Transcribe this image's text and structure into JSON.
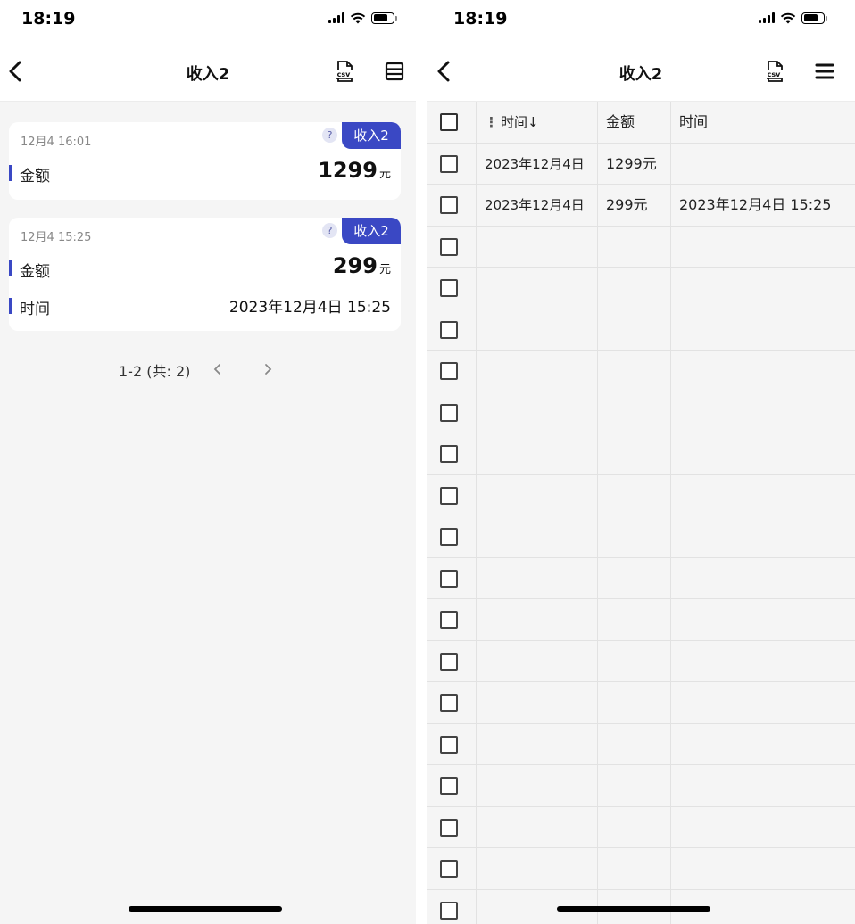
{
  "left": {
    "status": {
      "time": "18:19"
    },
    "nav": {
      "title": "收入2"
    },
    "records": [
      {
        "timestamp": "12月4 16:01",
        "help": "?",
        "tag": "收入2",
        "fields": [
          {
            "label": "金额",
            "value": "1299",
            "unit": "元"
          }
        ]
      },
      {
        "timestamp": "12月4 15:25",
        "help": "?",
        "tag": "收入2",
        "fields": [
          {
            "label": "金额",
            "value": "299",
            "unit": "元"
          },
          {
            "label": "时间",
            "value": "2023年12月4日 15:25"
          }
        ]
      }
    ],
    "pager": {
      "text": "1-2 (共: 2)"
    }
  },
  "right": {
    "status": {
      "time": "18:19"
    },
    "nav": {
      "title": "收入2"
    },
    "table": {
      "columns": [
        "时间↓",
        "金额",
        "时间"
      ],
      "rows": [
        [
          "2023年12月4日",
          "1299元",
          ""
        ],
        [
          "2023年12月4日",
          "299元",
          "2023年12月4日 15:25"
        ]
      ],
      "empty_rows": 17
    }
  },
  "colors": {
    "accent": "#3a48c4",
    "background": "#f5f5f5"
  },
  "icons": [
    "back-icon",
    "csv-icon",
    "list-view-icon",
    "menu-icon",
    "signal-icon",
    "wifi-icon",
    "battery-icon",
    "chevron-left-icon",
    "chevron-right-icon",
    "help-icon",
    "checkbox-icon",
    "column-menu-icon"
  ]
}
